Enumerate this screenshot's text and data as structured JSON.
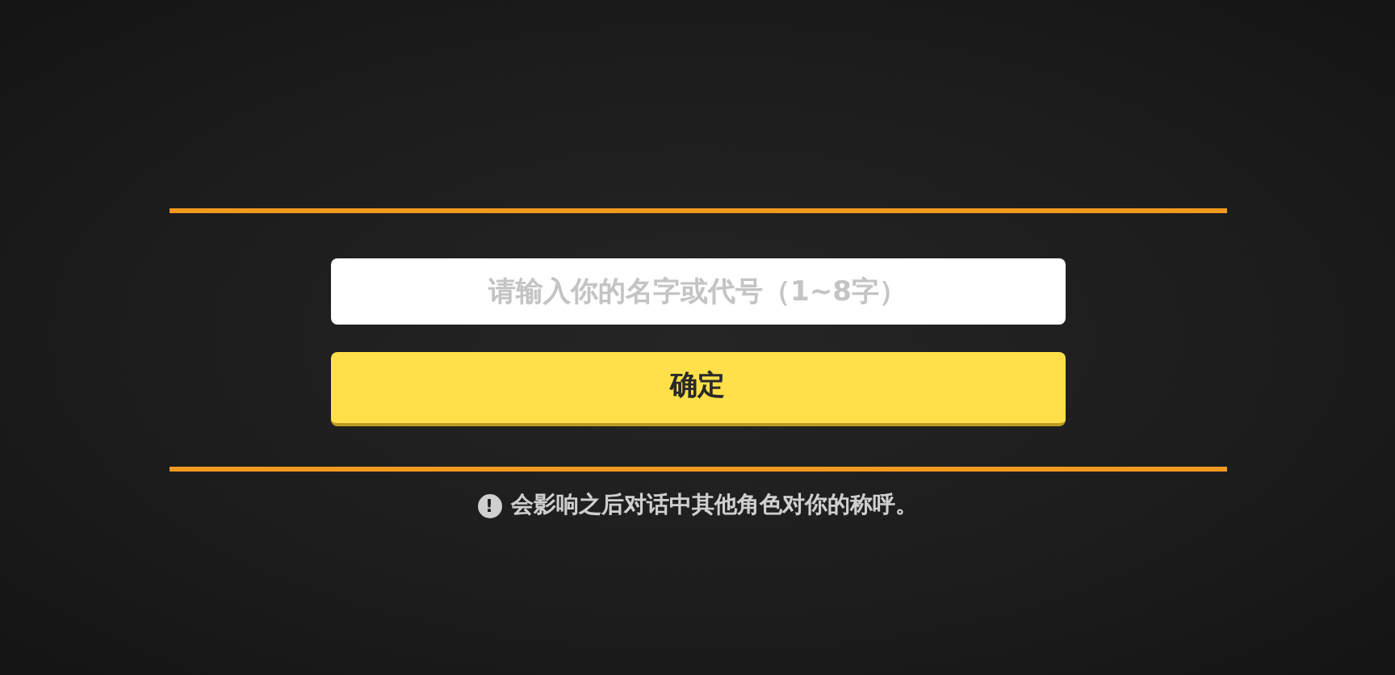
{
  "name_field": {
    "placeholder": "请输入你的名字或代号（1~8字）"
  },
  "confirm_button": {
    "label": "确定"
  },
  "note": {
    "icon": "!",
    "text": "会影响之后对话中其他角色对你的称呼。"
  }
}
